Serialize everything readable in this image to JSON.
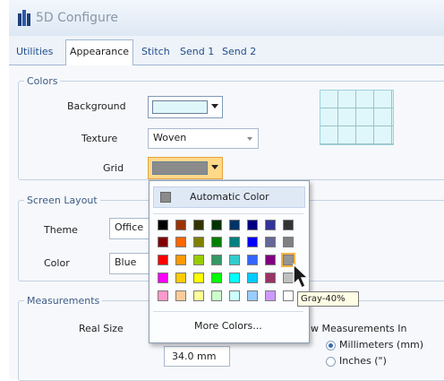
{
  "window": {
    "title": "5D Configure"
  },
  "tabs": [
    "Utilities",
    "Appearance",
    "Stitch",
    "Send 1",
    "Send 2"
  ],
  "colors": {
    "legend": "Colors",
    "background_label": "Background",
    "background_color": "#dff7fa",
    "texture_label": "Texture",
    "texture_value": "Woven",
    "grid_label": "Grid",
    "grid_color": "#8b8b8b"
  },
  "screen_layout": {
    "legend": "Screen Layout",
    "theme_label": "Theme",
    "theme_value": "Office",
    "color_label": "Color",
    "color_value": "Blue"
  },
  "measurements": {
    "legend": "Measurements",
    "real_size_label": "Real Size",
    "value": "34.0 mm",
    "show_in_label": "w Measurements In",
    "options": [
      "Millimeters (mm)",
      "Inches (\")"
    ],
    "selected": "Millimeters (mm)"
  },
  "color_picker": {
    "automatic_label": "Automatic Color",
    "more_label": "More Colors...",
    "tooltip": "Gray-40%",
    "selected_color": "Gray-40%",
    "rows": [
      [
        "#000000",
        "#993300",
        "#333300",
        "#003300",
        "#003366",
        "#000080",
        "#333399",
        "#333333"
      ],
      [
        "#800000",
        "#ff6600",
        "#808000",
        "#008000",
        "#008080",
        "#0000ff",
        "#666699",
        "#808080"
      ],
      [
        "#ff0000",
        "#ff9900",
        "#99cc00",
        "#339966",
        "#33cccc",
        "#3366ff",
        "#800080",
        "#969696"
      ],
      [
        "#ff00ff",
        "#ffcc00",
        "#ffff00",
        "#00ff00",
        "#00ffff",
        "#00ccff",
        "#993366",
        "#c0c0c0"
      ],
      [
        "#ff99cc",
        "#ffcc99",
        "#ffff99",
        "#ccffcc",
        "#ccffff",
        "#99ccff",
        "#cc99ff",
        "#ffffff"
      ]
    ]
  }
}
